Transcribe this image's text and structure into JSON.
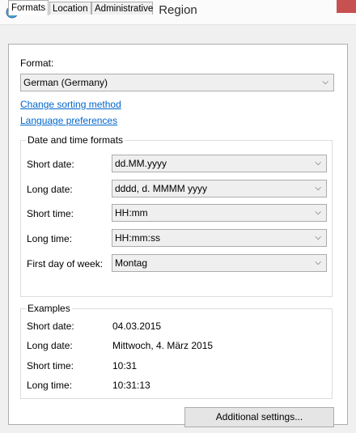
{
  "window": {
    "title": "Region"
  },
  "tabs": [
    {
      "label": "Formats",
      "active": true
    },
    {
      "label": "Location",
      "active": false
    },
    {
      "label": "Administrative",
      "active": false
    }
  ],
  "formats": {
    "format_label": "Format:",
    "format_value": "German (Germany)",
    "link_sorting": "Change sorting method",
    "link_language": "Language preferences",
    "datetime_group_title": "Date and time formats",
    "rows": [
      {
        "label": "Short date:",
        "value": "dd.MM.yyyy"
      },
      {
        "label": "Long date:",
        "value": "dddd, d. MMMM yyyy"
      },
      {
        "label": "Short time:",
        "value": "HH:mm"
      },
      {
        "label": "Long time:",
        "value": "HH:mm:ss"
      },
      {
        "label": "First day of week:",
        "value": "Montag"
      }
    ],
    "examples_title": "Examples",
    "examples": [
      {
        "label": "Short date:",
        "value": "04.03.2015"
      },
      {
        "label": "Long date:",
        "value": "Mittwoch, 4. März 2015"
      },
      {
        "label": "Short time:",
        "value": "10:31"
      },
      {
        "label": "Long time:",
        "value": "10:31:13"
      }
    ],
    "additional_settings_label": "Additional settings..."
  },
  "icons": {
    "app": "globe-icon",
    "dropdown": "chevron-down-icon"
  },
  "colors": {
    "link": "#0066cc",
    "close_button": "#c75050"
  }
}
